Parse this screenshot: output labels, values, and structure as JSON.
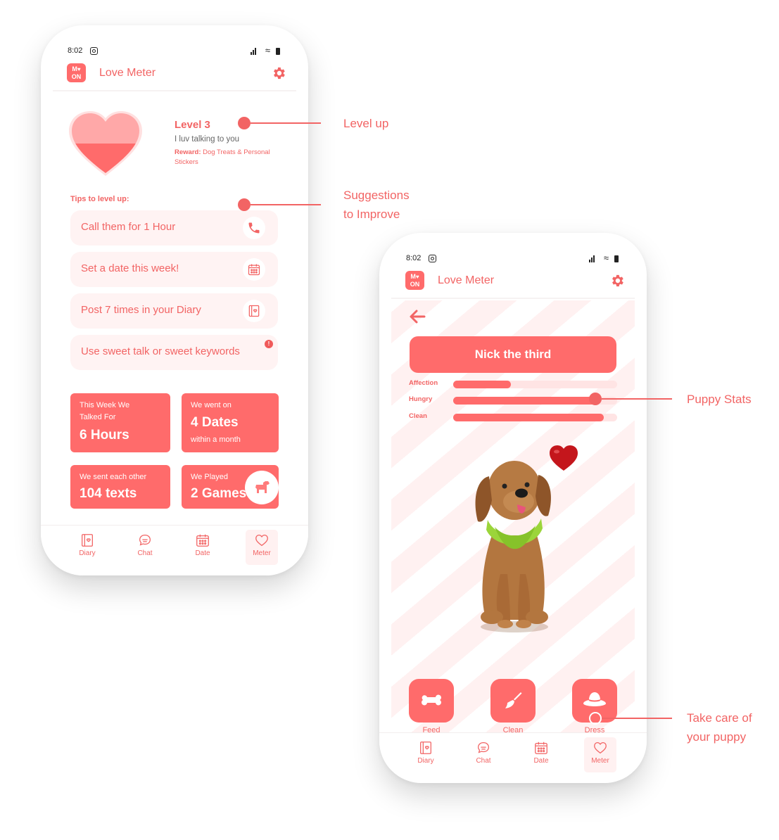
{
  "status": {
    "time": "8:02"
  },
  "app": {
    "logo_text": "M♥ ON",
    "title": "Love Meter"
  },
  "level": {
    "title": "Level 3",
    "subtitle": "I luv talking to you",
    "reward_label": "Reward:",
    "reward_text": "Dog Treats & Personal Stickers"
  },
  "tips": {
    "heading": "Tips to level up:",
    "items": [
      {
        "label": "Call them for 1 Hour",
        "icon": "phone-icon"
      },
      {
        "label": "Set a date this week!",
        "icon": "calendar-icon"
      },
      {
        "label": "Post 7 times in your Diary",
        "icon": "diary-icon"
      },
      {
        "label": "Use sweet talk or sweet keywords",
        "icon": "alert-badge",
        "badge": "!"
      }
    ]
  },
  "stats": [
    {
      "small": "This Week We\nTalked For",
      "big": "6 Hours"
    },
    {
      "small_top": "We went on",
      "big": "4 Dates",
      "small_bottom": "within a month"
    },
    {
      "small": "We sent each other",
      "big": "104 texts"
    },
    {
      "small": "We Played",
      "big": "2 Games"
    }
  ],
  "nav": [
    "Diary",
    "Chat",
    "Date",
    "Meter"
  ],
  "puppy": {
    "name": "Nick the third",
    "stats": [
      {
        "label": "Affection",
        "level": 0.35
      },
      {
        "label": "Hungry",
        "level": 0.88
      },
      {
        "label": "Clean",
        "level": 0.92
      }
    ],
    "actions": [
      {
        "label": "Feed",
        "icon": "bone-icon"
      },
      {
        "label": "Clean",
        "icon": "broom-icon"
      },
      {
        "label": "Dress",
        "icon": "hat-icon"
      }
    ]
  },
  "annotations": {
    "level_up": "Level up",
    "suggestions": "Suggestions\nto Improve",
    "puppy_stats": "Puppy Stats",
    "take_care": "Take care of\nyour puppy"
  },
  "colors": {
    "primary": "#ff6b6b",
    "accent_text": "#f26464",
    "light": "#fff3f3"
  }
}
